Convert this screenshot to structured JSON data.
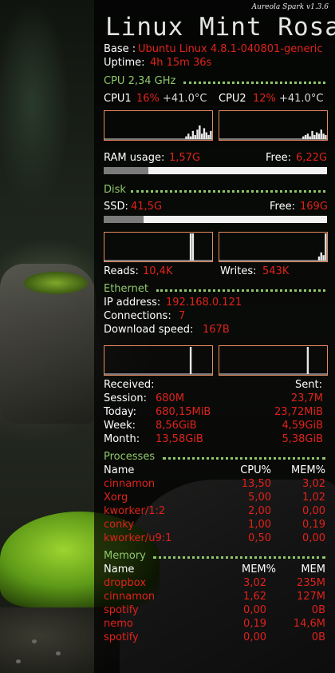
{
  "widget": {
    "version": "Aureola Spark v1.3.6",
    "title": "Linux Mint Rosa"
  },
  "system": {
    "base_label": "Base :",
    "base_value": "Ubuntu Linux 4.8.1-040801-generic",
    "uptime_label": "Uptime:",
    "uptime_value": "4h 15m 36s"
  },
  "cpu": {
    "header": "CPU 2,34 GHz",
    "cores": [
      {
        "label": "CPU1",
        "usage": "16%",
        "temp": "+41.0°C",
        "activity": [
          0,
          0,
          0,
          0,
          0,
          0,
          0,
          0,
          0,
          0,
          0,
          0,
          0,
          0,
          0,
          0,
          0,
          0,
          0,
          0,
          0,
          0,
          0,
          0,
          0,
          0,
          0,
          0,
          0,
          0,
          0,
          0,
          0,
          0,
          0,
          0,
          0.1,
          0.2,
          0.1,
          0.3,
          0.15,
          0.35,
          0.5,
          0.2,
          0.4,
          0.25,
          0.15,
          0.3
        ]
      },
      {
        "label": "CPU2",
        "usage": "12%",
        "temp": "+41.0°C",
        "activity": [
          0,
          0,
          0,
          0,
          0,
          0,
          0,
          0,
          0,
          0,
          0,
          0,
          0,
          0,
          0,
          0,
          0,
          0,
          0,
          0,
          0,
          0,
          0,
          0,
          0,
          0,
          0,
          0,
          0,
          0,
          0,
          0,
          0,
          0,
          0,
          0,
          0,
          0.1,
          0.15,
          0.2,
          0.1,
          0.3,
          0.15,
          0.25,
          0.2,
          0.35,
          0.2,
          0.15
        ]
      }
    ]
  },
  "ram": {
    "label": "RAM usage:",
    "used": "1,57G",
    "free_label": "Free:",
    "free": "6,22G",
    "used_fraction": 0.2
  },
  "disk": {
    "header": "Disk",
    "ssd_label": "SSD:",
    "ssd_used": "41,5G",
    "free_label": "Free:",
    "ssd_free": "169G",
    "used_fraction": 0.18,
    "read_activity": [
      0,
      0,
      0,
      0,
      0,
      0,
      0,
      0,
      0,
      0,
      0,
      0,
      0,
      0,
      0,
      0,
      0,
      0,
      0,
      0,
      0,
      0,
      0,
      0,
      0,
      0,
      0,
      0,
      0,
      0,
      0,
      0,
      0,
      0,
      0,
      0,
      0,
      0,
      1,
      1,
      0,
      0,
      0,
      0,
      0,
      0,
      0,
      0
    ],
    "write_activity": [
      0,
      0,
      0,
      0,
      0,
      0,
      0,
      0,
      0,
      0,
      0,
      0,
      0,
      0,
      0,
      0,
      0,
      0,
      0,
      0,
      0,
      0,
      0,
      0,
      0,
      0,
      0,
      0,
      0,
      0,
      0,
      0,
      0,
      0,
      0,
      0,
      0,
      0,
      0,
      0,
      0,
      0,
      0,
      0,
      0.15,
      0.3,
      0.2,
      1
    ],
    "reads_label": "Reads:",
    "reads": "10,4K",
    "writes_label": "Writes:",
    "writes": "543K"
  },
  "ethernet": {
    "header": "Ethernet",
    "ip_label": "IP address:",
    "ip": "192.168.0.121",
    "connections_label": "Connections:",
    "connections": "7",
    "download_label": "Download speed:",
    "download": "167B",
    "down_activity": [
      0,
      0,
      0,
      0,
      0,
      0,
      0,
      0,
      0,
      0,
      0,
      0,
      0,
      0,
      0,
      0,
      0,
      0,
      0,
      0,
      0,
      0,
      0,
      0,
      0,
      0,
      0,
      0,
      0,
      0,
      0,
      0,
      0,
      0,
      0,
      0,
      0,
      0,
      1,
      0,
      0,
      0,
      0,
      0,
      0,
      0,
      0,
      0
    ],
    "up_activity": [
      0,
      0,
      0,
      0,
      0,
      0,
      0,
      0,
      0,
      0,
      0,
      0,
      0,
      0,
      0,
      0,
      0,
      0,
      0,
      0,
      0,
      0,
      0,
      0,
      0,
      0,
      0,
      0,
      0,
      0,
      0,
      0,
      0,
      0,
      0,
      0,
      0,
      0,
      0,
      1,
      0,
      0,
      0,
      0,
      0,
      0,
      0,
      0
    ],
    "received_label": "Received:",
    "sent_label": "Sent:",
    "rows": [
      {
        "label": "Session:",
        "received": "680M",
        "sent": "23,7M"
      },
      {
        "label": "Today:",
        "received": "680,15MiB",
        "sent": "23,72MiB"
      },
      {
        "label": "Week:",
        "received": "8,56GiB",
        "sent": "4,59GiB"
      },
      {
        "label": "Month:",
        "received": "13,58GiB",
        "sent": "5,38GiB"
      }
    ]
  },
  "processes": {
    "header": "Processes",
    "columns": [
      "Name",
      "CPU%",
      "MEM%"
    ],
    "rows": [
      {
        "name": "cinnamon",
        "cpu": "13,50",
        "mem": "3,02"
      },
      {
        "name": "Xorg",
        "cpu": "5,00",
        "mem": "1,02"
      },
      {
        "name": "kworker/1:2",
        "cpu": "2,00",
        "mem": "0,00"
      },
      {
        "name": "conky",
        "cpu": "1,00",
        "mem": "0,19"
      },
      {
        "name": "kworker/u9:1",
        "cpu": "0,50",
        "mem": "0,00"
      }
    ]
  },
  "memory": {
    "header": "Memory",
    "columns": [
      "Name",
      "MEM%",
      "MEM"
    ],
    "rows": [
      {
        "name": "dropbox",
        "pct": "3,02",
        "mem": "235M"
      },
      {
        "name": "cinnamon",
        "pct": "1,62",
        "mem": "127M"
      },
      {
        "name": "spotify",
        "pct": "0,00",
        "mem": "0B"
      },
      {
        "name": "nemo",
        "pct": "0,19",
        "mem": "14,6M"
      },
      {
        "name": "spotify",
        "pct": "0,00",
        "mem": "0B"
      }
    ]
  },
  "colors": {
    "accent_green": "#8ec86a",
    "value_red": "#e0221a",
    "graph_border": "#e88a60"
  }
}
